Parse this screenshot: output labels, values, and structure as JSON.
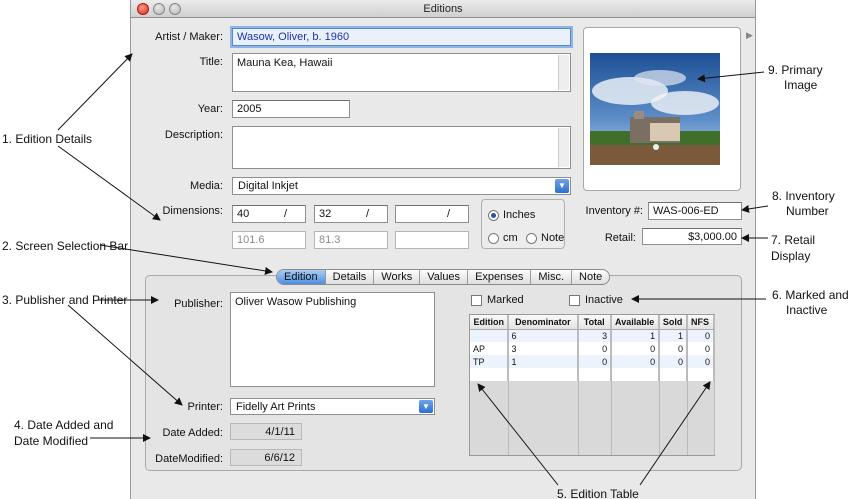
{
  "window": {
    "title": "Editions"
  },
  "form": {
    "artist_label": "Artist / Maker:",
    "artist_value": "Wasow, Oliver, b. 1960",
    "title_label": "Title:",
    "title_value": "Mauna Kea, Hawaii",
    "year_label": "Year:",
    "year_value": "2005",
    "description_label": "Description:",
    "description_value": "",
    "media_label": "Media:",
    "media_value": "Digital Inkjet",
    "dimensions_label": "Dimensions:",
    "dim1": "40",
    "dim2": "32",
    "dim3": "",
    "slash": "/",
    "conv1": "101.6",
    "conv2": "81.3",
    "conv3": "",
    "units": {
      "inches": "Inches",
      "cm": "cm",
      "note": "Note",
      "selected": "Inches"
    },
    "inventory_label": "Inventory #:",
    "inventory_value": "WAS-006-ED",
    "retail_label": "Retail:",
    "retail_value": "$3,000.00"
  },
  "tabs": [
    "Edition",
    "Details",
    "Works",
    "Values",
    "Expenses",
    "Misc.",
    "Note"
  ],
  "active_tab": "Edition",
  "edition_screen": {
    "publisher_label": "Publisher:",
    "publisher_value": "Oliver Wasow Publishing",
    "printer_label": "Printer:",
    "printer_value": "Fidelly Art Prints",
    "date_added_label": "Date Added:",
    "date_added_value": "4/1/11",
    "date_modified_label": "DateModified:",
    "date_modified_value": "6/6/12",
    "marked_label": "Marked",
    "inactive_label": "Inactive",
    "table": {
      "headers": [
        "Edition",
        "Denominator",
        "Total",
        "Available",
        "Sold",
        "NFS"
      ],
      "rows": [
        [
          "",
          "6",
          "3",
          "1",
          "1",
          "0"
        ],
        [
          "AP",
          "3",
          "0",
          "0",
          "0",
          "0"
        ],
        [
          "TP",
          "1",
          "0",
          "0",
          "0",
          "0"
        ]
      ]
    }
  },
  "callouts": {
    "c1": "1. Edition Details",
    "c2": "2. Screen Selection Bar",
    "c3": "3. Publisher and Printer",
    "c4a": "4. Date Added and",
    "c4b": "Date Modified",
    "c5": "5. Edition Table",
    "c6a": "6. Marked and",
    "c6b": "Inactive",
    "c7": "7. Retail Display",
    "c8a": "8. Inventory",
    "c8b": "Number",
    "c9a": "9. Primary",
    "c9b": "Image"
  }
}
